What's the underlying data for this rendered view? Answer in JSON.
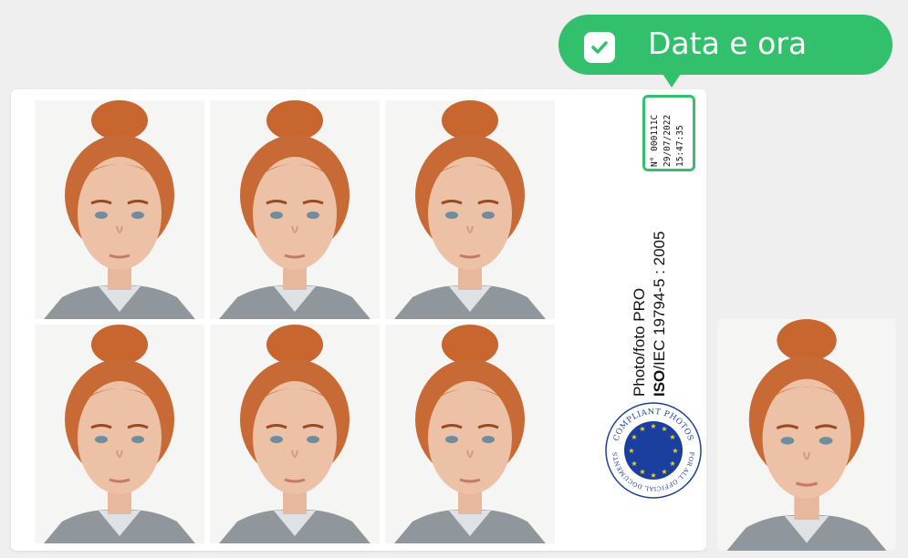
{
  "callout": {
    "label": "Data e ora",
    "icon": "check-icon",
    "color": "#33c06d"
  },
  "stamp": {
    "number": "N° 000111C",
    "date": "29/07/2022",
    "time": "15:47:35",
    "border_color": "#34c06e"
  },
  "sheet": {
    "title": "Photo/foto PRO",
    "iso_bold": "ISO",
    "iso_rest": "/IEC 19794-5 : 2005",
    "photo_count": 6
  },
  "seal": {
    "top_text": "COMPLIANT PHOTOS",
    "bottom_text": "FOR ALL OFFICIAL DOCUMENTS",
    "icon": "eu-stars-icon",
    "color": "#1b3f9e"
  },
  "single_photo": {
    "icon": "portrait-photo"
  }
}
